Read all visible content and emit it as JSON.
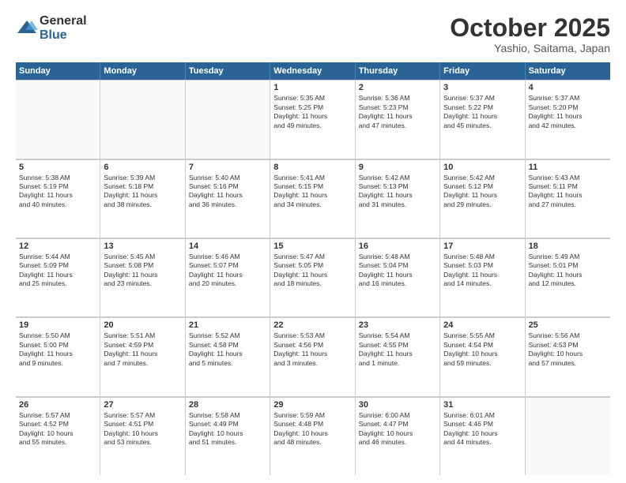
{
  "logo": {
    "general": "General",
    "blue": "Blue"
  },
  "title": "October 2025",
  "location": "Yashio, Saitama, Japan",
  "days": [
    "Sunday",
    "Monday",
    "Tuesday",
    "Wednesday",
    "Thursday",
    "Friday",
    "Saturday"
  ],
  "weeks": [
    [
      {
        "day": "",
        "info": ""
      },
      {
        "day": "",
        "info": ""
      },
      {
        "day": "",
        "info": ""
      },
      {
        "day": "1",
        "info": "Sunrise: 5:35 AM\nSunset: 5:25 PM\nDaylight: 11 hours\nand 49 minutes."
      },
      {
        "day": "2",
        "info": "Sunrise: 5:36 AM\nSunset: 5:23 PM\nDaylight: 11 hours\nand 47 minutes."
      },
      {
        "day": "3",
        "info": "Sunrise: 5:37 AM\nSunset: 5:22 PM\nDaylight: 11 hours\nand 45 minutes."
      },
      {
        "day": "4",
        "info": "Sunrise: 5:37 AM\nSunset: 5:20 PM\nDaylight: 11 hours\nand 42 minutes."
      }
    ],
    [
      {
        "day": "5",
        "info": "Sunrise: 5:38 AM\nSunset: 5:19 PM\nDaylight: 11 hours\nand 40 minutes."
      },
      {
        "day": "6",
        "info": "Sunrise: 5:39 AM\nSunset: 5:18 PM\nDaylight: 11 hours\nand 38 minutes."
      },
      {
        "day": "7",
        "info": "Sunrise: 5:40 AM\nSunset: 5:16 PM\nDaylight: 11 hours\nand 36 minutes."
      },
      {
        "day": "8",
        "info": "Sunrise: 5:41 AM\nSunset: 5:15 PM\nDaylight: 11 hours\nand 34 minutes."
      },
      {
        "day": "9",
        "info": "Sunrise: 5:42 AM\nSunset: 5:13 PM\nDaylight: 11 hours\nand 31 minutes."
      },
      {
        "day": "10",
        "info": "Sunrise: 5:42 AM\nSunset: 5:12 PM\nDaylight: 11 hours\nand 29 minutes."
      },
      {
        "day": "11",
        "info": "Sunrise: 5:43 AM\nSunset: 5:11 PM\nDaylight: 11 hours\nand 27 minutes."
      }
    ],
    [
      {
        "day": "12",
        "info": "Sunrise: 5:44 AM\nSunset: 5:09 PM\nDaylight: 11 hours\nand 25 minutes."
      },
      {
        "day": "13",
        "info": "Sunrise: 5:45 AM\nSunset: 5:08 PM\nDaylight: 11 hours\nand 23 minutes."
      },
      {
        "day": "14",
        "info": "Sunrise: 5:46 AM\nSunset: 5:07 PM\nDaylight: 11 hours\nand 20 minutes."
      },
      {
        "day": "15",
        "info": "Sunrise: 5:47 AM\nSunset: 5:05 PM\nDaylight: 11 hours\nand 18 minutes."
      },
      {
        "day": "16",
        "info": "Sunrise: 5:48 AM\nSunset: 5:04 PM\nDaylight: 11 hours\nand 16 minutes."
      },
      {
        "day": "17",
        "info": "Sunrise: 5:48 AM\nSunset: 5:03 PM\nDaylight: 11 hours\nand 14 minutes."
      },
      {
        "day": "18",
        "info": "Sunrise: 5:49 AM\nSunset: 5:01 PM\nDaylight: 11 hours\nand 12 minutes."
      }
    ],
    [
      {
        "day": "19",
        "info": "Sunrise: 5:50 AM\nSunset: 5:00 PM\nDaylight: 11 hours\nand 9 minutes."
      },
      {
        "day": "20",
        "info": "Sunrise: 5:51 AM\nSunset: 4:59 PM\nDaylight: 11 hours\nand 7 minutes."
      },
      {
        "day": "21",
        "info": "Sunrise: 5:52 AM\nSunset: 4:58 PM\nDaylight: 11 hours\nand 5 minutes."
      },
      {
        "day": "22",
        "info": "Sunrise: 5:53 AM\nSunset: 4:56 PM\nDaylight: 11 hours\nand 3 minutes."
      },
      {
        "day": "23",
        "info": "Sunrise: 5:54 AM\nSunset: 4:55 PM\nDaylight: 11 hours\nand 1 minute."
      },
      {
        "day": "24",
        "info": "Sunrise: 5:55 AM\nSunset: 4:54 PM\nDaylight: 10 hours\nand 59 minutes."
      },
      {
        "day": "25",
        "info": "Sunrise: 5:56 AM\nSunset: 4:53 PM\nDaylight: 10 hours\nand 57 minutes."
      }
    ],
    [
      {
        "day": "26",
        "info": "Sunrise: 5:57 AM\nSunset: 4:52 PM\nDaylight: 10 hours\nand 55 minutes."
      },
      {
        "day": "27",
        "info": "Sunrise: 5:57 AM\nSunset: 4:51 PM\nDaylight: 10 hours\nand 53 minutes."
      },
      {
        "day": "28",
        "info": "Sunrise: 5:58 AM\nSunset: 4:49 PM\nDaylight: 10 hours\nand 51 minutes."
      },
      {
        "day": "29",
        "info": "Sunrise: 5:59 AM\nSunset: 4:48 PM\nDaylight: 10 hours\nand 48 minutes."
      },
      {
        "day": "30",
        "info": "Sunrise: 6:00 AM\nSunset: 4:47 PM\nDaylight: 10 hours\nand 46 minutes."
      },
      {
        "day": "31",
        "info": "Sunrise: 6:01 AM\nSunset: 4:46 PM\nDaylight: 10 hours\nand 44 minutes."
      },
      {
        "day": "",
        "info": ""
      }
    ]
  ]
}
